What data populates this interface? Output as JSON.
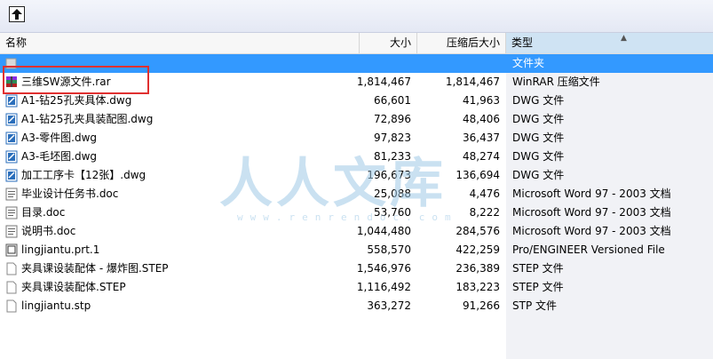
{
  "toolbar": {
    "up_icon": "up-folder-icon"
  },
  "columns": {
    "name": "名称",
    "size": "大小",
    "packed": "压缩后大小",
    "type": "类型"
  },
  "rows": [
    {
      "name": "",
      "size": "",
      "packed": "",
      "type": "文件夹",
      "icon": "folder-up-icon",
      "selected": true
    },
    {
      "name": "三维SW源文件.rar",
      "size": "1,814,467",
      "packed": "1,814,467",
      "type": "WinRAR 压缩文件",
      "icon": "winrar-archive-icon"
    },
    {
      "name": "A1-钻25孔夹具体.dwg",
      "size": "66,601",
      "packed": "41,963",
      "type": "DWG 文件",
      "icon": "dwg-file-icon"
    },
    {
      "name": "A1-钻25孔夹具装配图.dwg",
      "size": "72,896",
      "packed": "48,406",
      "type": "DWG 文件",
      "icon": "dwg-file-icon"
    },
    {
      "name": "A3-零件图.dwg",
      "size": "97,823",
      "packed": "36,437",
      "type": "DWG 文件",
      "icon": "dwg-file-icon"
    },
    {
      "name": "A3-毛坯图.dwg",
      "size": "81,233",
      "packed": "48,274",
      "type": "DWG 文件",
      "icon": "dwg-file-icon"
    },
    {
      "name": "加工工序卡【12张】.dwg",
      "size": "196,673",
      "packed": "136,694",
      "type": "DWG 文件",
      "icon": "dwg-file-icon"
    },
    {
      "name": "毕业设计任务书.doc",
      "size": "25,088",
      "packed": "4,476",
      "type": "Microsoft Word 97 - 2003 文档",
      "icon": "word-doc-icon"
    },
    {
      "name": "目录.doc",
      "size": "53,760",
      "packed": "8,222",
      "type": "Microsoft Word 97 - 2003 文档",
      "icon": "word-doc-icon"
    },
    {
      "name": "说明书.doc",
      "size": "1,044,480",
      "packed": "284,576",
      "type": "Microsoft Word 97 - 2003 文档",
      "icon": "word-doc-icon"
    },
    {
      "name": "lingjiantu.prt.1",
      "size": "558,570",
      "packed": "422,259",
      "type": "Pro/ENGINEER Versioned File",
      "icon": "proe-file-icon"
    },
    {
      "name": "夹具课设装配体 - 爆炸图.STEP",
      "size": "1,546,976",
      "packed": "236,389",
      "type": "STEP 文件",
      "icon": "blank-file-icon"
    },
    {
      "name": "夹具课设装配体.STEP",
      "size": "1,116,492",
      "packed": "183,223",
      "type": "STEP 文件",
      "icon": "blank-file-icon"
    },
    {
      "name": "lingjiantu.stp",
      "size": "363,272",
      "packed": "91,266",
      "type": "STP 文件",
      "icon": "blank-file-icon"
    }
  ],
  "watermark": {
    "text": "人人文库",
    "url": "www.renrendoc.com"
  },
  "colors": {
    "selection": "#3399ff",
    "highlight": "#e03030",
    "type_column": "#cfe3f3"
  }
}
